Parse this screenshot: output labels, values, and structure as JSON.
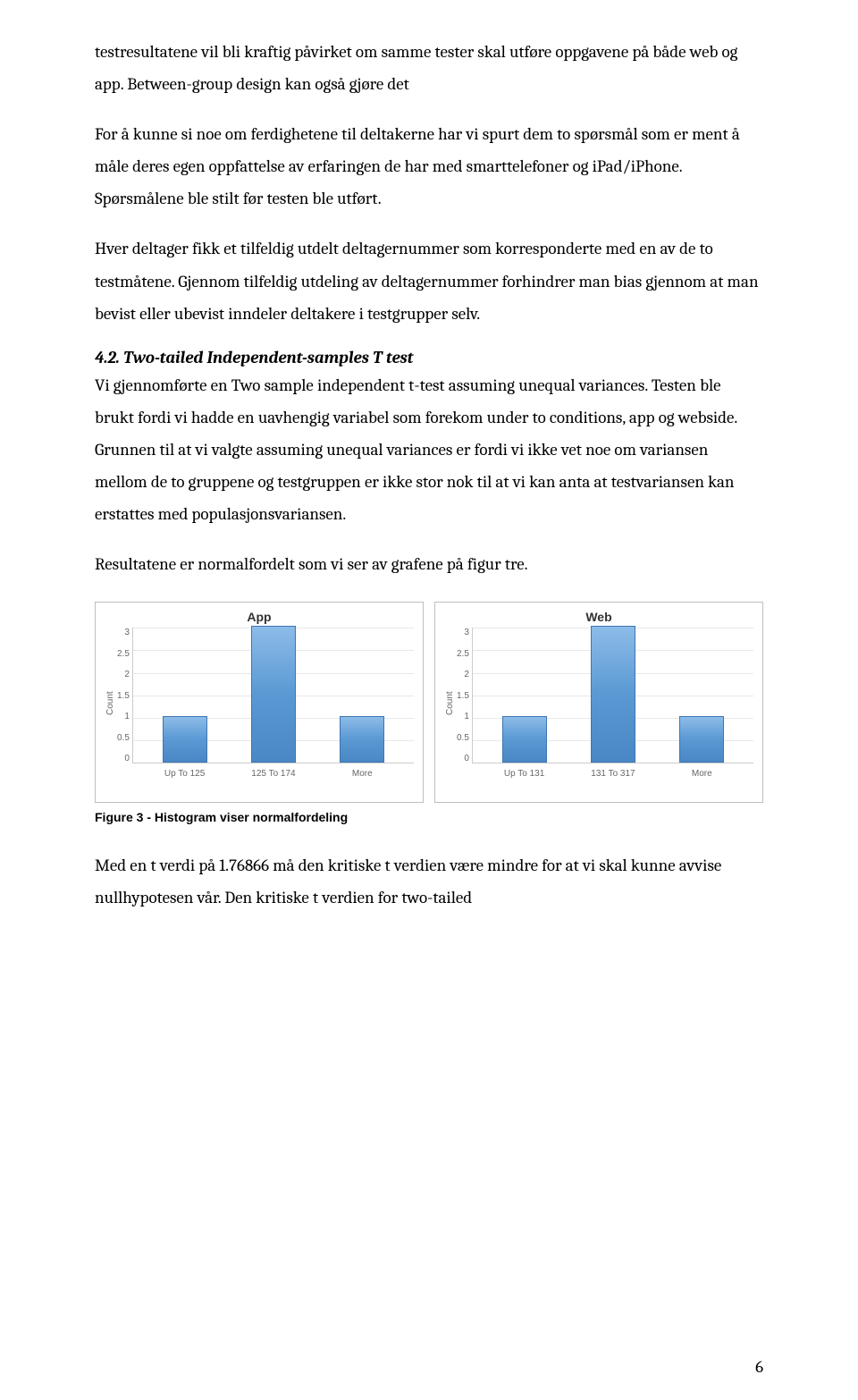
{
  "paragraphs": {
    "p1": "testresultatene vil bli kraftig påvirket om samme tester skal utføre oppgavene på både web og app. Between-group design kan også gjøre det",
    "p2": "For å kunne si  noe om ferdighetene til deltakerne har vi spurt dem to spørsmål som er ment å måle deres egen oppfattelse av erfaringen de har med smarttelefoner og iPad/iPhone. Spørsmålene ble stilt før testen ble utført.",
    "p3": "Hver deltager fikk et tilfeldig utdelt deltagernummer som korresponderte med en av de to testmåtene. Gjennom tilfeldig utdeling av deltagernummer forhindrer man bias gjennom at man bevist eller ubevist inndeler deltakere i testgrupper selv.",
    "heading": "4.2. Two-tailed Independent-samples T test",
    "p4": "Vi gjennomførte en Two sample independent t-test assuming unequal variances. Testen ble brukt fordi vi hadde en uavhengig variabel som forekom under to conditions, app og webside.",
    "p5": "Grunnen til at vi valgte assuming unequal variances er fordi vi ikke vet noe om variansen mellom de to gruppene og testgruppen er ikke stor nok til at vi kan anta at testvariansen kan erstattes med populasjonsvariansen.",
    "p6": "Resultatene er normalfordelt som vi ser av grafene på figur tre.",
    "p7": "Med en t verdi på 1.76866 må den kritiske t verdien være mindre for at vi skal kunne avvise nullhypotesen vår. Den kritiske t verdien for two-tailed"
  },
  "figure_caption": "Figure 3 - Histogram viser normalfordeling",
  "page_number": "6",
  "chart_data": [
    {
      "type": "bar",
      "title": "App",
      "ylabel": "Count",
      "categories": [
        "Up To 125",
        "125 To 174",
        "More"
      ],
      "values": [
        1,
        3,
        1
      ],
      "yticks": [
        "3",
        "2.5",
        "2",
        "1.5",
        "1",
        "0.5",
        "0"
      ],
      "ylim": [
        0,
        3
      ]
    },
    {
      "type": "bar",
      "title": "Web",
      "ylabel": "Count",
      "categories": [
        "Up To 131",
        "131 To 317",
        "More"
      ],
      "values": [
        1,
        3,
        1
      ],
      "yticks": [
        "3",
        "2.5",
        "2",
        "1.5",
        "1",
        "0.5",
        "0"
      ],
      "ylim": [
        0,
        3
      ]
    }
  ]
}
